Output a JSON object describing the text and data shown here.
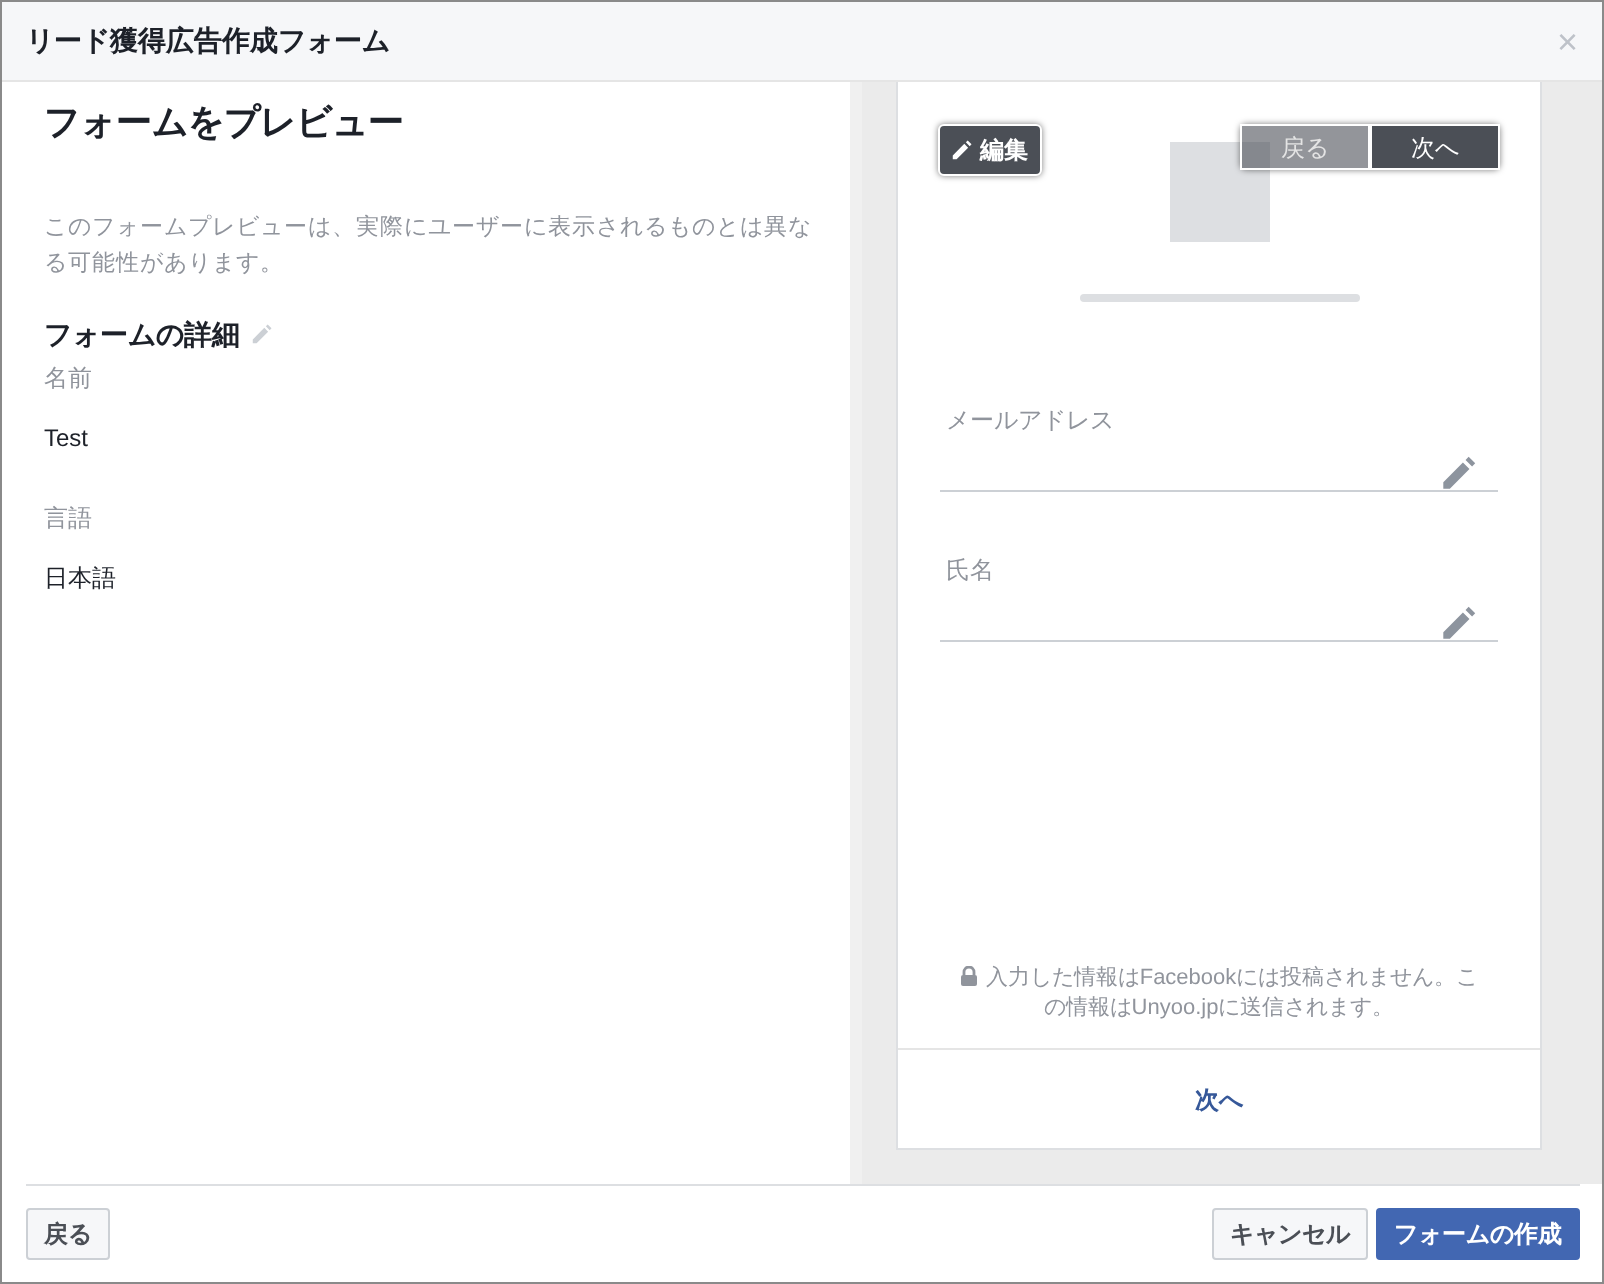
{
  "window": {
    "title": "リード獲得広告作成フォーム",
    "close": "×"
  },
  "left": {
    "heading": "フォームをプレビュー",
    "note": "このフォームプレビューは、実際にユーザーに表示されるものとは異なる可能性があります。",
    "section_title": "フォームの詳細",
    "details": [
      {
        "label": "名前",
        "value": "Test"
      },
      {
        "label": "言語",
        "value": "日本語"
      }
    ]
  },
  "preview": {
    "edit_button": "編集",
    "nav_buttons": [
      {
        "label": "戻る",
        "disabled": true
      },
      {
        "label": "次へ",
        "disabled": false
      }
    ],
    "fields": [
      {
        "label": "メールアドレス"
      },
      {
        "label": "氏名"
      }
    ],
    "privacy_note": "入力した情報はFacebookには投稿されません。この情報はUnyoo.jpに送信されます。",
    "next_link": "次へ"
  },
  "footer": {
    "back_button": "戻る",
    "buttons": [
      {
        "label": "キャンセル",
        "kind": "secondary"
      },
      {
        "label": "フォームの作成",
        "kind": "primary"
      }
    ]
  }
}
